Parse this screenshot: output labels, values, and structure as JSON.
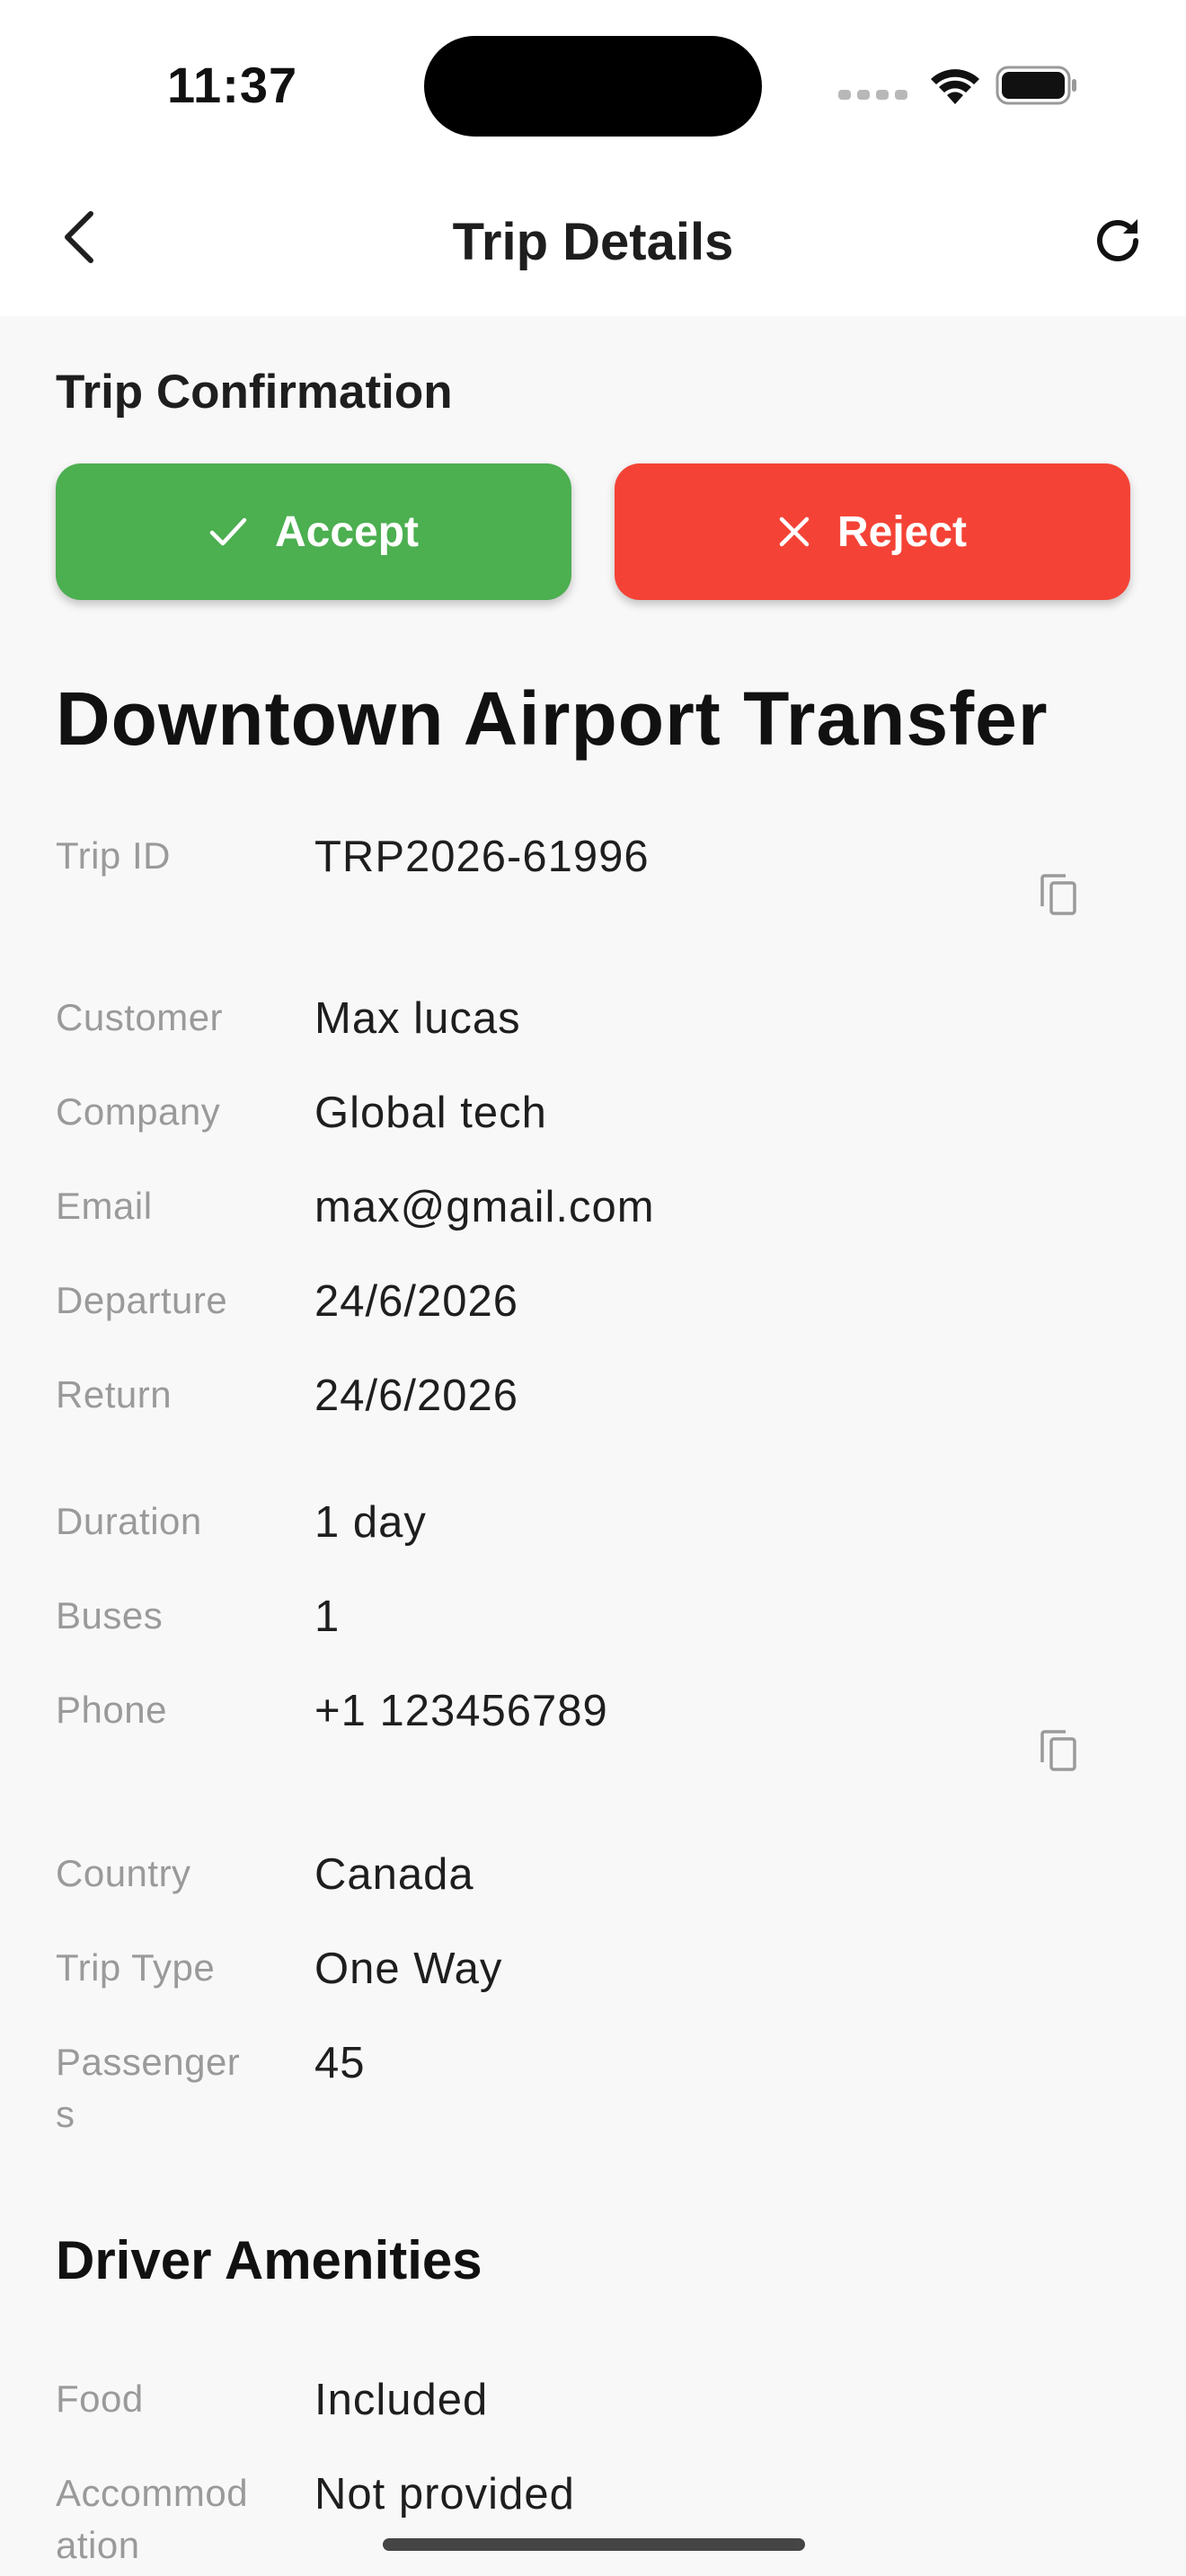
{
  "status_bar": {
    "time": "11:37"
  },
  "header": {
    "title": "Trip Details",
    "back_icon": "chevron-left-icon",
    "refresh_icon": "refresh-icon"
  },
  "confirmation": {
    "label": "Trip Confirmation",
    "accept_label": "Accept",
    "reject_label": "Reject",
    "accept_color": "#4caf50",
    "reject_color": "#f44336"
  },
  "trip": {
    "title": "Downtown Airport Transfer",
    "fields": [
      {
        "label": "Trip ID",
        "value": "TRP2026-61996",
        "copyable": true
      },
      {
        "label": "Customer",
        "value": "Max lucas"
      },
      {
        "label": "Company",
        "value": "Global tech"
      },
      {
        "label": "Email",
        "value": "max@gmail.com"
      },
      {
        "label": "Departure",
        "value": "24/6/2026"
      },
      {
        "label": "Return",
        "value": "24/6/2026"
      },
      {
        "label": "Duration",
        "value": "1 day"
      },
      {
        "label": "Buses",
        "value": "1"
      },
      {
        "label": "Phone",
        "value": "+1 123456789",
        "copyable": true
      },
      {
        "label": "Country",
        "value": "Canada"
      },
      {
        "label": "Trip Type",
        "value": "One Way"
      },
      {
        "label": "Passenger\ns",
        "value": "45"
      }
    ]
  },
  "amenities": {
    "title": "Driver Amenities",
    "fields": [
      {
        "label": "Food",
        "value": "Included"
      },
      {
        "label": "Accommod\nation",
        "value": "Not provided"
      }
    ]
  }
}
